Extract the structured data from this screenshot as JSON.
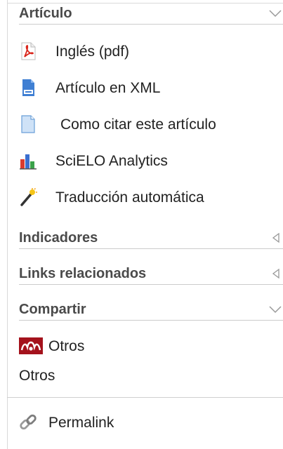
{
  "sections": {
    "articulo": {
      "title": "Artículo"
    },
    "indicadores": {
      "title": "Indicadores"
    },
    "links": {
      "title": "Links relacionados"
    },
    "compartir": {
      "title": "Compartir"
    }
  },
  "articulo_items": [
    {
      "label": "Inglés (pdf)",
      "icon": "pdf-icon"
    },
    {
      "label": "Artículo en XML",
      "icon": "xml-icon"
    },
    {
      "label": "Como citar este artículo",
      "icon": "document-icon"
    },
    {
      "label": "SciELO Analytics",
      "icon": "bar-chart-icon"
    },
    {
      "label": "Traducción automática",
      "icon": "magic-wand-icon"
    }
  ],
  "compartir_items": [
    {
      "label": "Otros",
      "icon": "mendeley-icon"
    }
  ],
  "compartir_plain": "Otros",
  "permalink": {
    "label": "Permalink",
    "icon": "chain-link-icon"
  },
  "colors": {
    "pdf_red": "#d9261c",
    "mendeley_red": "#a4121c",
    "header_text": "#4a4a4a"
  }
}
